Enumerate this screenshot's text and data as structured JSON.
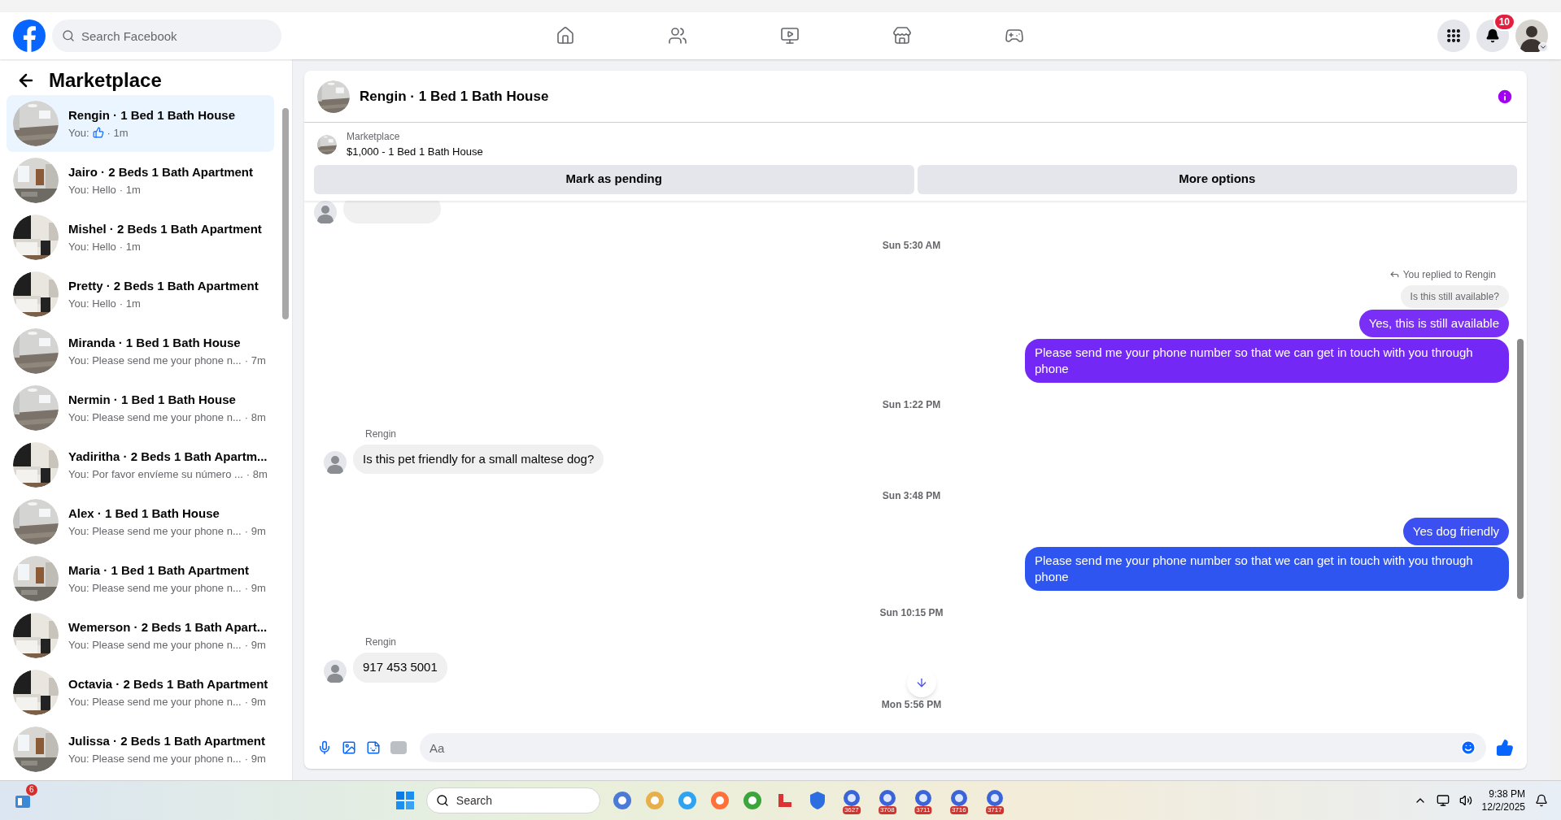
{
  "header": {
    "search": {
      "placeholder": "Search Facebook"
    },
    "nav": [
      {
        "kind": "home",
        "selected": false
      },
      {
        "kind": "friends",
        "selected": false
      },
      {
        "kind": "video",
        "selected": false
      },
      {
        "kind": "marketplace",
        "selected": false
      },
      {
        "kind": "gaming",
        "selected": false
      }
    ],
    "notifications_badge": "10"
  },
  "sidebar": {
    "title": "Marketplace",
    "conversations": [
      {
        "title": "Rengin · 1 Bed 1 Bath House",
        "preview": "You:",
        "like": true,
        "time": "· 1m",
        "selected": true
      },
      {
        "title": "Jairo · 2 Beds 1 Bath Apartment",
        "preview": "You: Hello",
        "like": false,
        "time": "· 1m",
        "selected": false
      },
      {
        "title": "Mishel · 2 Beds 1 Bath Apartment",
        "preview": "You: Hello",
        "like": false,
        "time": "· 1m",
        "selected": false
      },
      {
        "title": "Pretty · 2 Beds 1 Bath Apartment",
        "preview": "You: Hello",
        "like": false,
        "time": "· 1m",
        "selected": false
      },
      {
        "title": "Miranda · 1 Bed 1 Bath House",
        "preview": "You: Please send me your phone n...",
        "like": false,
        "time": "· 7m",
        "selected": false
      },
      {
        "title": "Nermin · 1 Bed 1 Bath House",
        "preview": "You: Please send me your phone n...",
        "like": false,
        "time": "· 8m",
        "selected": false
      },
      {
        "title": "Yadiritha · 2 Beds 1 Bath Apartm...",
        "preview": "You: Por favor envíeme su número ...",
        "like": false,
        "time": "· 8m",
        "selected": false
      },
      {
        "title": "Alex · 1 Bed 1 Bath House",
        "preview": "You: Please send me your phone n...",
        "like": false,
        "time": "· 9m",
        "selected": false
      },
      {
        "title": "Maria · 1 Bed 1 Bath Apartment",
        "preview": "You: Please send me your phone n...",
        "like": false,
        "time": "· 9m",
        "selected": false
      },
      {
        "title": "Wemerson · 2 Beds 1 Bath Apart...",
        "preview": "You: Please send me your phone n...",
        "like": false,
        "time": "· 9m",
        "selected": false
      },
      {
        "title": "Octavia · 2 Beds 1 Bath Apartment",
        "preview": "You: Please send me your phone n...",
        "like": false,
        "time": "· 9m",
        "selected": false
      },
      {
        "title": "Julissa · 2 Beds 1 Bath Apartment",
        "preview": "You: Please send me your phone n...",
        "like": false,
        "time": "· 9m",
        "selected": false
      }
    ]
  },
  "chat": {
    "title": "Rengin · 1 Bed 1 Bath House",
    "listing": {
      "source": "Marketplace",
      "summary": "$1,000 - 1 Bed 1 Bath House"
    },
    "buttons": [
      "Mark as pending",
      "More options"
    ],
    "messages": [
      {
        "kind": "cut"
      },
      {
        "kind": "timestamp",
        "text": "Sun 5:30 AM"
      },
      {
        "kind": "reply",
        "label": "You replied to Rengin",
        "quote": "Is this still available?"
      },
      {
        "kind": "outgoing",
        "text": "Yes, this is still available",
        "color": "#7a2ff7"
      },
      {
        "kind": "outgoing",
        "text": "Please send me your phone  number so that we can get in touch with you through phone",
        "color": "#7328f5"
      },
      {
        "kind": "timestamp",
        "text": "Sun 1:22 PM"
      },
      {
        "kind": "incoming",
        "sender": "Rengin",
        "text": "Is this pet friendly for a small maltese dog?"
      },
      {
        "kind": "timestamp",
        "text": "Sun 3:48 PM"
      },
      {
        "kind": "outgoing",
        "text": "Yes dog friendly",
        "color": "#3c4ff0"
      },
      {
        "kind": "outgoing",
        "text": "Please send me your phone  number so that we can get in touch with you through phone",
        "color": "#2e55f0"
      },
      {
        "kind": "timestamp",
        "text": "Sun 10:15 PM"
      },
      {
        "kind": "incoming",
        "sender": "Rengin",
        "text": "917 453 5001"
      },
      {
        "kind": "timestamp",
        "text": "Mon 5:56 PM"
      }
    ],
    "composer": {
      "placeholder": "Aa"
    }
  },
  "taskbar": {
    "widgets_badge": "6",
    "search": {
      "placeholder": "Search"
    },
    "app_badges": [
      "3627",
      "3708",
      "3711",
      "3716",
      "3717"
    ],
    "time": "9:38 PM",
    "date": "12/2/2025"
  }
}
